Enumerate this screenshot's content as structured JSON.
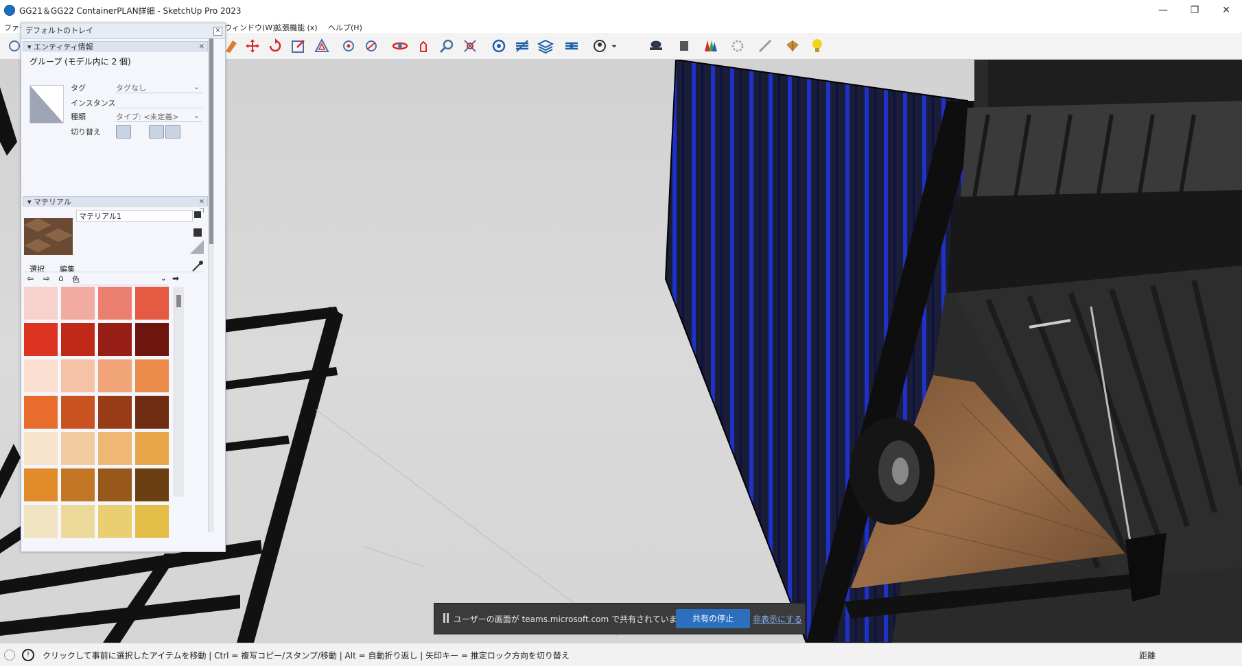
{
  "window": {
    "title": "GG21＆GG22 ContainerPLAN詳細 - SketchUp Pro 2023",
    "minimize": "—",
    "maximize": "❐",
    "close": "✕"
  },
  "menu": {
    "file_partial": "ファイ",
    "window": "ウィンドウ(W)",
    "extensions": "拡張機能 (x)",
    "help": "ヘルプ(H)"
  },
  "tray": {
    "title": "デフォルトのトレイ",
    "entity_info": {
      "header": "エンティティ情報",
      "name": "グループ (モデル内に 2 個)",
      "tag_label": "タグ",
      "tag_value": "タグなし",
      "instance_label": "インスタンス",
      "type_label": "種類",
      "type_value": "タイプ: <未定義>",
      "toggle_label": "切り替え"
    },
    "materials": {
      "header": "マテリアル",
      "name": "マテリアル1",
      "tab_select": "選択",
      "tab_edit": "編集",
      "collection": "色",
      "swatch_colors": [
        [
          "#f7d2cc",
          "#f1aba0",
          "#ec8070",
          "#e45a42"
        ],
        [
          "#dc3420",
          "#c02818",
          "#971e14",
          "#6d150e"
        ],
        [
          "#fbe0d2",
          "#f6c2a6",
          "#f1a578",
          "#ec8c4a"
        ],
        [
          "#e86d2c",
          "#c85220",
          "#983c18",
          "#6f2c12"
        ],
        [
          "#f7e4cc",
          "#f2cb9e",
          "#eeb774",
          "#e9a648"
        ],
        [
          "#e28b2a",
          "#c27522",
          "#97581a",
          "#6b3f12"
        ],
        [
          "#f2e4c2",
          "#ecd99a",
          "#e9ce72",
          "#e3bd48"
        ]
      ]
    }
  },
  "share_banner": {
    "message": "ユーザーの画面が teams.microsoft.com で共有されています。",
    "stop_button": "共有の停止",
    "hide_link": "非表示にする"
  },
  "statusbar": {
    "info": "クリックして事前に選択したアイテムを移動 | Ctrl = 複写コピー/スタンプ/移動 | Alt = 自動折り返し | 矢印キー = 推定ロック方向を切り替え",
    "distance_label": "距離"
  }
}
